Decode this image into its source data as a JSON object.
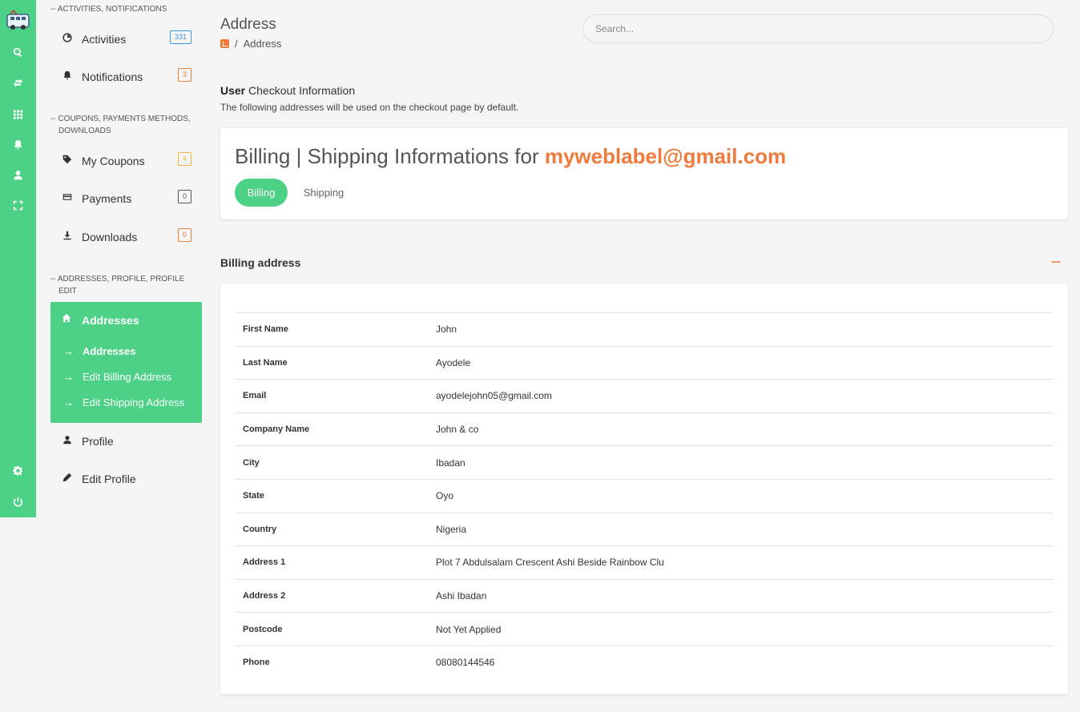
{
  "rail": {
    "icons": [
      "search-icon",
      "transfer-icon",
      "apps-grid-icon",
      "bell-icon",
      "user-icon",
      "fullscreen-icon",
      "settings-icon",
      "power-icon"
    ]
  },
  "menu": {
    "sections": {
      "activities": "-- ACTIVITIES, NOTIFICATIONS",
      "coupons_line1": "-- COUPONS, PAYMENTS METHODS,",
      "coupons_line2": "DOWNLOADS",
      "addresses_line1": "-- ADDRESSES, PROFILE, PROFILE",
      "addresses_line2": "EDIT"
    },
    "items": {
      "activities": {
        "label": "Activities",
        "badge": "331",
        "badge_color": "#3a9ad9"
      },
      "notifications": {
        "label": "Notifications",
        "badge": "3",
        "badge_color": "#ef7b3a"
      },
      "coupons": {
        "label": "My Coupons",
        "badge": "4",
        "badge_color": "#f0b43a"
      },
      "payments": {
        "label": "Payments",
        "badge": "0",
        "badge_color": "#555555"
      },
      "downloads": {
        "label": "Downloads",
        "badge": "0",
        "badge_color": "#ef7b3a"
      },
      "profile": {
        "label": "Profile"
      },
      "edit_profile": {
        "label": "Edit Profile"
      }
    },
    "addresses": {
      "label": "Addresses",
      "sub": [
        "Addresses",
        "Edit Billing Address",
        "Edit Shipping Address"
      ],
      "arrow": "→"
    }
  },
  "header": {
    "title": "Address",
    "breadcrumb_sep": "/",
    "breadcrumb_current": "Address",
    "search_placeholder": "Search..."
  },
  "intro": {
    "bold": "User",
    "title": " Checkout Information",
    "subtitle": "The following addresses will be used on the checkout page by default."
  },
  "info_card": {
    "heading": "Billing | Shipping Informations for ",
    "email": "myweblabel@gmail.com",
    "tabs": [
      "Billing",
      "Shipping"
    ]
  },
  "billing": {
    "title": "Billing address",
    "more": "---",
    "rows": [
      {
        "key": "First Name",
        "value": "John"
      },
      {
        "key": "Last Name",
        "value": "Ayodele"
      },
      {
        "key": "Email",
        "value": "ayodelejohn05@gmail.com"
      },
      {
        "key": "Company Name",
        "value": "John & co"
      },
      {
        "key": "City",
        "value": "Ibadan"
      },
      {
        "key": "State",
        "value": "Oyo"
      },
      {
        "key": "Country",
        "value": "Nigeria"
      },
      {
        "key": "Address 1",
        "value": "Plot 7 Abdulsalam Crescent Ashi Beside Rainbow Clu"
      },
      {
        "key": "Address 2",
        "value": "Ashi Ibadan"
      },
      {
        "key": "Postcode",
        "value": "Not Yet Applied"
      },
      {
        "key": "Phone",
        "value": "08080144546"
      }
    ]
  },
  "colors": {
    "accent": "#4cd187",
    "highlight": "#ef7b3a"
  }
}
